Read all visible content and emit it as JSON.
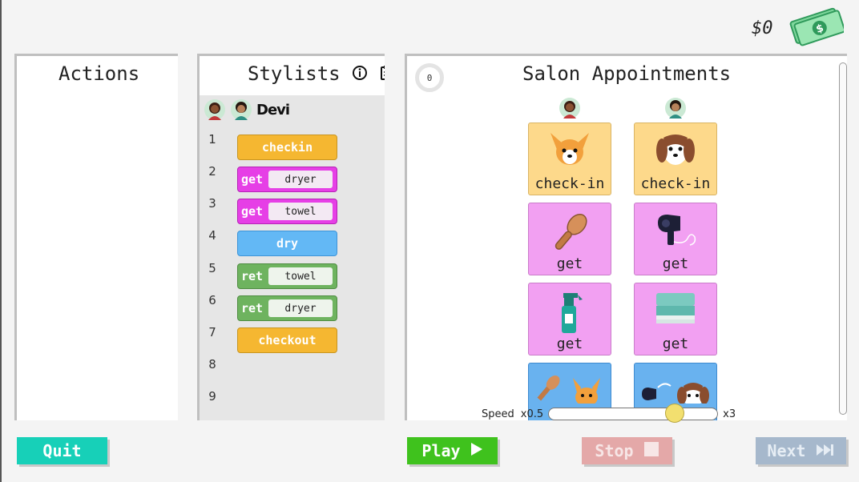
{
  "money": {
    "amount": "$0"
  },
  "actions": {
    "title": "Actions"
  },
  "stylists": {
    "title": "Stylists",
    "active_stylist": "Devi",
    "line_numbers": [
      "1",
      "2",
      "3",
      "4",
      "5",
      "6",
      "7",
      "8",
      "9"
    ],
    "blocks": [
      {
        "kind": "plain",
        "color": "orange",
        "label": "checkin"
      },
      {
        "kind": "arg",
        "color": "pink",
        "keyword": "get",
        "arg": "dryer"
      },
      {
        "kind": "arg",
        "color": "pink",
        "keyword": "get",
        "arg": "towel"
      },
      {
        "kind": "plain",
        "color": "blue",
        "label": "dry"
      },
      {
        "kind": "arg",
        "color": "green",
        "keyword": "ret",
        "arg": "towel"
      },
      {
        "kind": "arg",
        "color": "green",
        "keyword": "ret",
        "arg": "dryer"
      },
      {
        "kind": "plain",
        "color": "orange",
        "label": "checkout"
      }
    ]
  },
  "appointments": {
    "title": "Salon Appointments",
    "timer": "0",
    "columns": [
      {
        "cards": [
          {
            "label": "check-in",
            "color": "#fdd98b",
            "icon": "chihuahua-icon"
          },
          {
            "label": "get",
            "color": "#f2a0f2",
            "icon": "brush-icon"
          },
          {
            "label": "get",
            "color": "#f2a0f2",
            "icon": "spray-bottle-icon"
          },
          {
            "label": "",
            "color": "#69b2ef",
            "icon": "brush-chihuahua-icon"
          }
        ]
      },
      {
        "cards": [
          {
            "label": "check-in",
            "color": "#fdd98b",
            "icon": "beagle-icon"
          },
          {
            "label": "get",
            "color": "#f2a0f2",
            "icon": "hair-dryer-icon"
          },
          {
            "label": "get",
            "color": "#f2a0f2",
            "icon": "towel-icon"
          },
          {
            "label": "",
            "color": "#69b2ef",
            "icon": "dryer-beagle-icon"
          }
        ]
      }
    ]
  },
  "speed": {
    "label": "Speed",
    "min_label": "x0.5",
    "max_label": "x3",
    "value_fraction": 0.78
  },
  "buttons": {
    "quit": "Quit",
    "play": "Play",
    "stop": "Stop",
    "next": "Next"
  }
}
